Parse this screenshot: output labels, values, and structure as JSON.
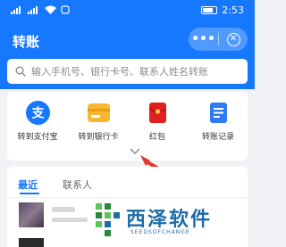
{
  "status_bar": {
    "time": "2:53"
  },
  "header": {
    "title": "转账",
    "more_label": "•••",
    "close_label": "✕"
  },
  "search": {
    "placeholder": "输入手机号、银行卡号、联系人姓名转账"
  },
  "quick_actions": [
    {
      "label": "转到支付宝",
      "icon": "alipay-icon",
      "color": "#1677ff"
    },
    {
      "label": "转到银行卡",
      "icon": "bank-card-icon",
      "color": "#f5a623"
    },
    {
      "label": "红包",
      "icon": "red-envelope-icon",
      "color": "#e02020"
    },
    {
      "label": "转账记录",
      "icon": "transfer-record-icon",
      "color": "#2f7bf5"
    }
  ],
  "contacts": {
    "tabs": [
      {
        "label": "最近",
        "active": true
      },
      {
        "label": "联系人",
        "active": false
      }
    ]
  },
  "watermark": {
    "title": "西泽软件",
    "subtitle": "SEEDSOFCHANGE"
  },
  "colors": {
    "accent": "#1677ff",
    "annotation_arrow": "#e8352e"
  }
}
